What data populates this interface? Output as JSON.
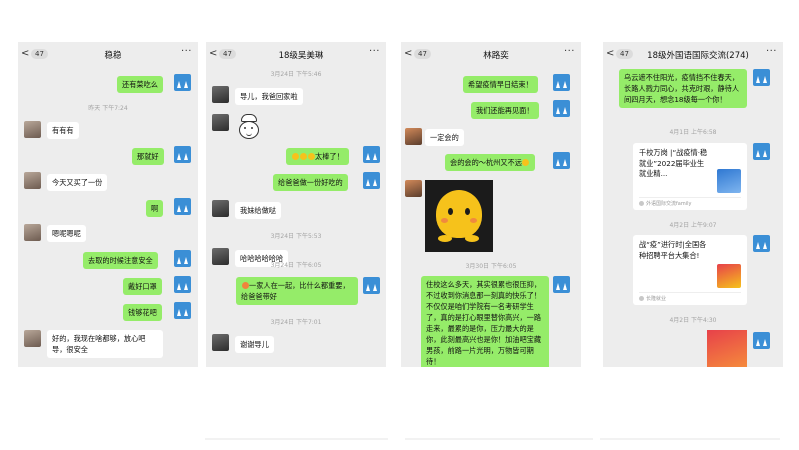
{
  "panels": [
    {
      "back": "<",
      "badge": "47",
      "title": "稳稳",
      "more": "···",
      "messages": [
        "还有菜吃么",
        "昨天 下午7:24",
        "有有有",
        "那就好",
        "今天又买了一份",
        "啊",
        "嗯呢嗯呢",
        "去取的时候注意安全",
        "戴好口罩",
        "钱够花吧",
        "好的，我现在啥都够，放心吧导，很安全"
      ]
    },
    {
      "back": "<",
      "badge": "47",
      "title": "18级吴美琳",
      "more": "···",
      "messages": [
        "3月24日 下午5:46",
        "导儿，我爸回家啦",
        "太棒了！",
        "给爸爸做一份好吃的",
        "我妹给做哒",
        "3月24日 下午5:53",
        "哈哈哈哈哈哈",
        "3月24日 下午6:05",
        "一家人在一起，比什么都重要，给爸爸带好",
        "3月24日 下午7:01",
        "谢谢导儿"
      ]
    },
    {
      "back": "<",
      "badge": "47",
      "title": "林路奕",
      "more": "···",
      "messages": [
        "希望疫情早日结束！",
        "我们还能再见面！",
        "一定会的",
        "会的会的～杭州又不远",
        "3月30日 下午6:05",
        "住校这么多天，其实很累也很压抑，不过收到你消息那一刻真的快乐了！不仅仅是咱们学院有一名考研学生了，真的是打心眼里替你高兴，一路走来，最累的是你，压力最大的是你，此刻最高兴也是你！加油吧宝藏男孩，前路一片光明，万物皆可期待！"
      ]
    },
    {
      "back": "<",
      "badge": "47",
      "title": "18级外国语国际交流(274)",
      "more": "···",
      "messages": [
        "乌云遮不住阳光，疫情挡不住春天，长路人戮力同心，共克时艰，静待人间四月天，想念18级每一个你！",
        "4月1日 上午6:58",
        "千校万岗 |“战疫情·稳就业”2022届毕业生就业精...",
        "外语国际交流family",
        "4月2日 上午9:07",
        "战“疫”进行时|全国各种招聘平台大集合!",
        "长隆就业",
        "4月2日 下午4:30"
      ]
    }
  ]
}
